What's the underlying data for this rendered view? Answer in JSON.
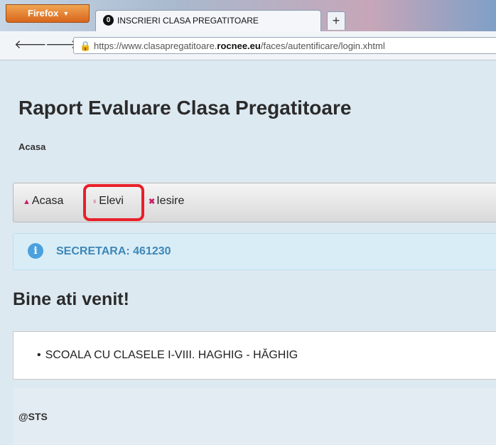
{
  "browser": {
    "menu_label": "Firefox",
    "tab_title": "INSCRIERI CLASA PREGATITOARE",
    "new_tab_label": "+",
    "url_prefix": "https://www.clasapregatitoare.",
    "url_domain": "rocnee.eu",
    "url_path": "/faces/autentificare/login.xhtml"
  },
  "page": {
    "title": "Raport Evaluare Clasa Pregatitoare",
    "breadcrumb": "Acasa"
  },
  "menu": {
    "items": [
      {
        "label": "Acasa",
        "icon": "home-icon"
      },
      {
        "label": "Elevi",
        "icon": "user-icon"
      },
      {
        "label": "Iesire",
        "icon": "close-icon"
      }
    ],
    "highlight_color": "#e8202a"
  },
  "info": {
    "text": "SECRETARA: 461230",
    "icon": "info-icon"
  },
  "welcome": "Bine ati venit!",
  "school": {
    "name": "SCOALA CU CLASELE I-VIII. HAGHIG - HĂGHIG"
  },
  "footer": "@STS",
  "colors": {
    "accent": "#c9206a",
    "info_text": "#3e87b6",
    "firefox_orange": "#e07a2a"
  }
}
